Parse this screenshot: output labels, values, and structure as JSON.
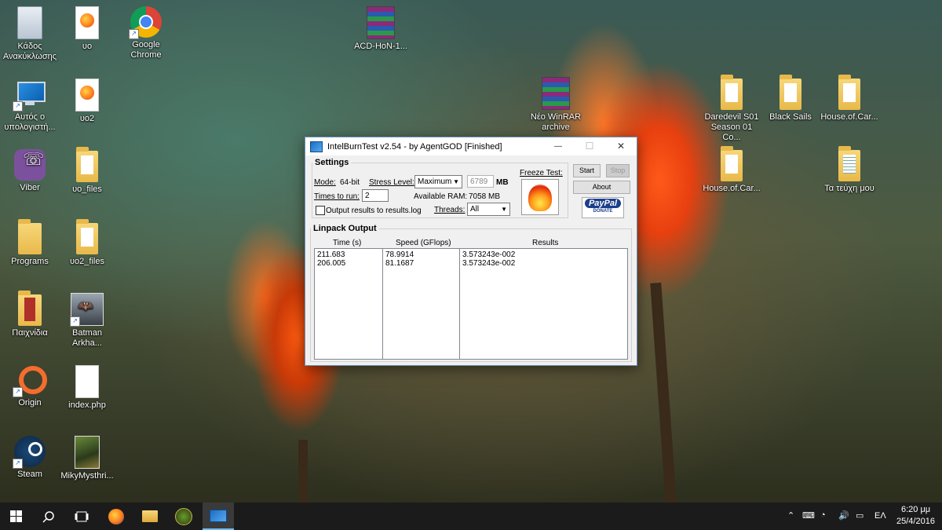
{
  "desktop": {
    "icons": [
      {
        "label": "Κάδος Ανακύκλωσης"
      },
      {
        "label": "Αυτός ο υπολογιστή..."
      },
      {
        "label": "Viber"
      },
      {
        "label": "Programs"
      },
      {
        "label": "Παιχνίδια"
      },
      {
        "label": "Origin"
      },
      {
        "label": "Steam"
      },
      {
        "label": "υο"
      },
      {
        "label": "υο2"
      },
      {
        "label": "υο_files"
      },
      {
        "label": "υο2_files"
      },
      {
        "label": "Batman Arkha..."
      },
      {
        "label": "index.php"
      },
      {
        "label": "MikyMysthri..."
      },
      {
        "label": "Google Chrome"
      },
      {
        "label": "ACD-HoN-1..."
      },
      {
        "label": "Νέο WinRAR archive"
      },
      {
        "label": "Daredevil S01 Season 01 Co..."
      },
      {
        "label": "Black Sails"
      },
      {
        "label": "House.of.Car..."
      },
      {
        "label": "House.of.Car..."
      },
      {
        "label": "Τα τεύχη μου"
      }
    ]
  },
  "window": {
    "title": "IntelBurnTest v2.54 - by AgentGOD [Finished]",
    "minimize": "—",
    "maximize": "☐",
    "close": "✕",
    "settings": {
      "legend": "Settings",
      "mode_label": "Mode:",
      "mode_value": "64-bit",
      "stress_label": "Stress Level:",
      "stress_value": "Maximum",
      "mem_value": "6789",
      "mem_unit": "MB",
      "times_label": "Times to run:",
      "times_value": "2",
      "ram_label": "Available RAM:",
      "ram_value": "7058 MB",
      "output_checkbox_label": "Output results to results.log",
      "threads_label": "Threads:",
      "threads_value": "All",
      "freeze_label": "Freeze Test:"
    },
    "buttons": {
      "start": "Start",
      "stop": "Stop",
      "about": "About",
      "paypal_top": "PayPal",
      "paypal_bottom": "DONATE"
    },
    "output": {
      "legend": "Linpack Output",
      "columns": [
        "Time (s)",
        "Speed (GFlops)",
        "Results"
      ],
      "rows": [
        {
          "time": "211.683",
          "speed": "78.9914",
          "result": "3.573243e-002"
        },
        {
          "time": "206.005",
          "speed": "81.1687",
          "result": "3.573243e-002"
        }
      ]
    }
  },
  "taskbar": {
    "language": "ΕΛ",
    "time": "6:20 μμ",
    "date": "25/4/2016"
  }
}
